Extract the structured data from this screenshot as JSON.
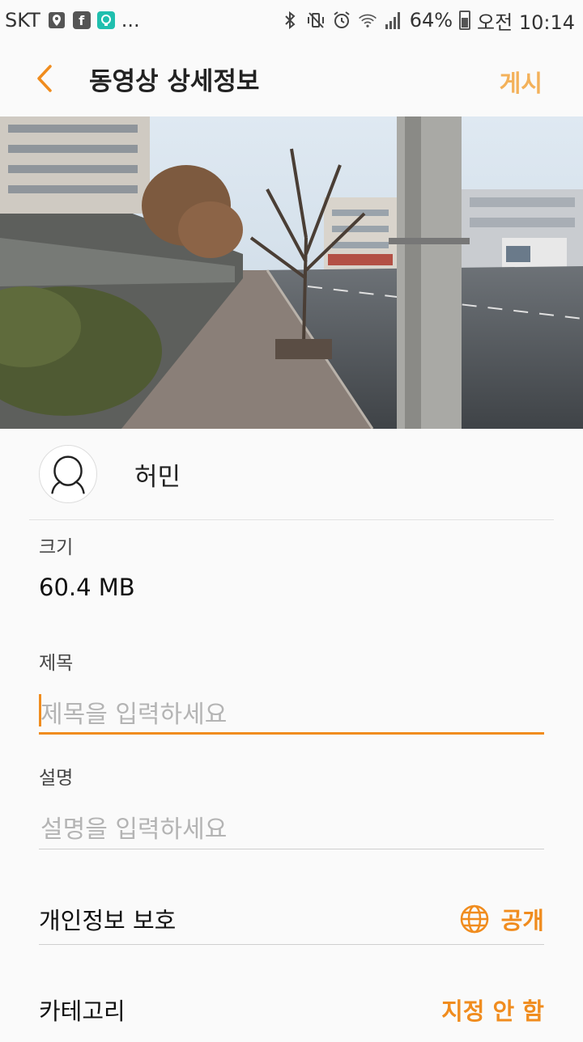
{
  "status_bar": {
    "carrier": "SKT",
    "more": "...",
    "battery_percent": "64%",
    "time": "오전 10:14"
  },
  "app_bar": {
    "title": "동영상 상세정보",
    "post_label": "게시"
  },
  "profile": {
    "name": "허민"
  },
  "size": {
    "label": "크기",
    "value": "60.4 MB"
  },
  "title_field": {
    "label": "제목",
    "placeholder": "제목을 입력하세요"
  },
  "description_field": {
    "label": "설명",
    "placeholder": "설명을 입력하세요"
  },
  "privacy": {
    "label": "개인정보 보호",
    "value": "공개"
  },
  "category": {
    "label": "카테고리",
    "value": "지정 안 함"
  },
  "colors": {
    "accent": "#f08c1e",
    "post_button": "#f3b15a"
  }
}
